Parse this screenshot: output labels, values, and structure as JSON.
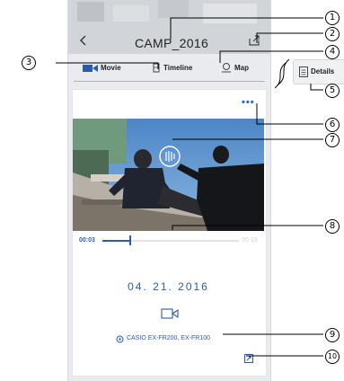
{
  "header": {
    "title": "CAMP_2016",
    "back_icon": "chevron-left-icon",
    "share_icon": "share-icon"
  },
  "tabs": [
    {
      "label": "Movie",
      "icon": "movie-camera-icon",
      "active": true
    },
    {
      "label": "Timeline",
      "icon": "timeline-icon",
      "active": false
    },
    {
      "label": "Map",
      "icon": "map-pin-icon",
      "active": false
    }
  ],
  "details": {
    "label": "Details",
    "icon": "document-icon"
  },
  "player": {
    "current_time": "00:03",
    "end_time": "00:13",
    "progress_fraction": 0.2
  },
  "info": {
    "date": "04. 21. 2016",
    "media_icon": "video-camera-icon",
    "camera": "CASIO EX-FR200, EX-FR100",
    "camera_icon": "camera-model-icon",
    "expand_icon": "expand-icon"
  },
  "callouts": [
    "1",
    "2",
    "3",
    "4",
    "5",
    "6",
    "7",
    "8",
    "9",
    "10"
  ],
  "colors": {
    "accent": "#2a5caa",
    "background": "#e9ebee"
  }
}
